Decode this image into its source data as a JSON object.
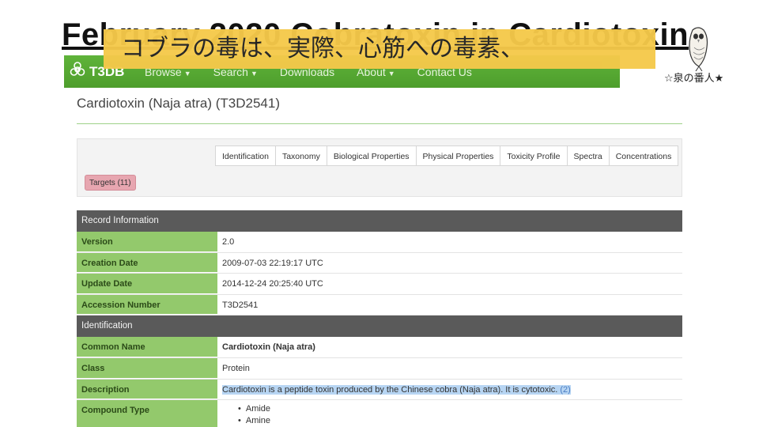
{
  "slide": {
    "title": "February 2020 Cobratoxin in Cardiotoxin",
    "caption": "コブラの毒は、実際、心筋への毒素、",
    "owl_caption": "☆泉の番人★"
  },
  "navbar": {
    "brand": "T3DB",
    "items": [
      {
        "label": "Browse"
      },
      {
        "label": "Search"
      },
      {
        "label": "Downloads"
      },
      {
        "label": "About"
      },
      {
        "label": "Contact Us"
      }
    ]
  },
  "page": {
    "title": "Cardiotoxin (Naja atra) (T3D2541)"
  },
  "tabs": [
    {
      "label": "Identification"
    },
    {
      "label": "Taxonomy"
    },
    {
      "label": "Biological Properties"
    },
    {
      "label": "Physical Properties"
    },
    {
      "label": "Toxicity Profile"
    },
    {
      "label": "Spectra"
    },
    {
      "label": "Concentrations"
    }
  ],
  "targets_tab": "Targets (11)",
  "record": {
    "heading": "Record Information",
    "rows": [
      {
        "label": "Version",
        "value": "2.0"
      },
      {
        "label": "Creation Date",
        "value": "2009-07-03 22:19:17 UTC"
      },
      {
        "label": "Update Date",
        "value": "2014-12-24 20:25:40 UTC"
      },
      {
        "label": "Accession Number",
        "value": "T3D2541"
      }
    ]
  },
  "identification": {
    "heading": "Identification",
    "common_name_label": "Common Name",
    "common_name": "Cardiotoxin (Naja atra)",
    "class_label": "Class",
    "class": "Protein",
    "description_label": "Description",
    "description": "Cardiotoxin is a peptide toxin produced by the Chinese cobra (Naja atra). It is cytotoxic.",
    "description_ref": "(2)",
    "compound_type_label": "Compound Type",
    "compound_types": [
      "Amide",
      "Amine"
    ]
  },
  "colors": {
    "nav_green": "#4e9e2c",
    "label_green": "#93c96c",
    "section_gray": "#5a5a5a",
    "caption_yellow": "#f5c94a",
    "targets_pink": "#e7a6b0"
  }
}
